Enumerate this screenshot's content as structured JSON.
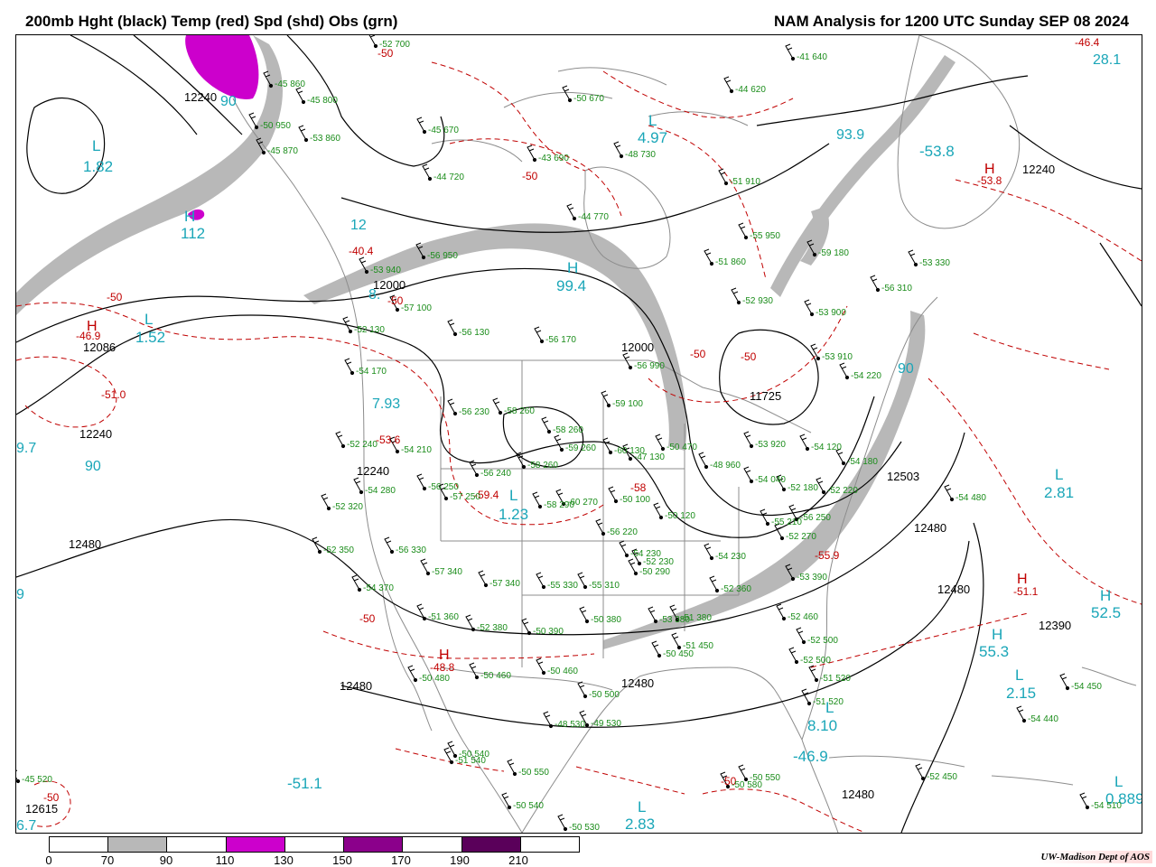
{
  "header": {
    "left_title": "200mb Hght (black) Temp (red) Spd (shd) Obs (grn)",
    "right_title": "NAM Analysis for 1200 UTC Sunday  SEP 08 2024"
  },
  "height_labels": [
    "12240",
    "12000",
    "12086",
    "12240",
    "12240",
    "12480",
    "12480",
    "12000",
    "11725",
    "12503",
    "12480",
    "12480",
    "12390",
    "12480",
    "12480",
    "12615",
    "12240"
  ],
  "temp_labels": [
    "-40.4",
    "-50",
    "-46.9",
    "-51.0",
    "-50",
    "-53.6",
    "-50",
    "-50",
    "-50",
    "-53.8",
    "-46.4",
    "-50",
    "-51.1",
    "-48.8",
    "-55.9",
    "-50",
    "-50",
    "-59.4",
    "-58",
    "-50"
  ],
  "pressure_centers": [
    {
      "symbol": "H",
      "value": "-46.9"
    },
    {
      "symbol": "L",
      "value": "1.82"
    },
    {
      "symbol": "H",
      "value": "112"
    },
    {
      "symbol": "L",
      "value": "1.52"
    },
    {
      "symbol": "H",
      "value": "99.4"
    },
    {
      "symbol": "L",
      "value": "4.97"
    },
    {
      "symbol": "L",
      "value": "1.23"
    },
    {
      "symbol": "L",
      "value": "2.81"
    },
    {
      "symbol": "H",
      "value": "55.3"
    },
    {
      "symbol": "L",
      "value": "2.15"
    },
    {
      "symbol": "H",
      "value": "52.5"
    },
    {
      "symbol": "L",
      "value": "2.83"
    },
    {
      "symbol": "L",
      "value": "8.10"
    },
    {
      "symbol": "H",
      "value": "-53.8"
    },
    {
      "symbol": "L",
      "value": "0.889"
    },
    {
      "symbol": "H",
      "value": "-51.1"
    }
  ],
  "speed_labels": [
    "7.93",
    "90",
    "93.9",
    "28.1",
    "90",
    "9.7",
    "9",
    "6.7",
    "8.",
    "90",
    "12"
  ],
  "observations": [
    "-45 860",
    "-45 800",
    "-50 950",
    "-53 860",
    "-52 700",
    "-53 940",
    "-45 870",
    "-45 670",
    "-44 720",
    "-43 690",
    "-50 670",
    "-48 730",
    "-41 640",
    "-44 620",
    "-51 910",
    "-55 950",
    "-44 770",
    "-59 180",
    "-51 860",
    "-53 330",
    "-52 930",
    "-53 900",
    "-53 910",
    "-56 950",
    "-56 310",
    "-57 100",
    "-56 130",
    "-56 170",
    "-52 130",
    "-54 170",
    "-52 240",
    "-54 210",
    "-56 230",
    "-58 260",
    "-58 260",
    "-59 260",
    "-60 130",
    "-59 100",
    "-56 990",
    "-54 220",
    "-54 180",
    "-54 120",
    "-54 280",
    "-56 250",
    "-57 250",
    "-56 240",
    "-58 260",
    "-58 290",
    "-60 270",
    "-56 220",
    "-48 960",
    "-53 920",
    "-54 040",
    "-52 180",
    "-52 220",
    "-52 320",
    "-52 350",
    "-56 330",
    "-57 340",
    "-57 340",
    "-55 330",
    "-55 310",
    "-54 230",
    "-54 230",
    "-55 210",
    "-52 270",
    "-56 250",
    "-53 390",
    "-54 370",
    "-51 360",
    "-52 380",
    "-50 390",
    "-50 380",
    "-53 380",
    "-51 380",
    "-52 360",
    "-52 460",
    "-52 500",
    "-52 500",
    "-51 520",
    "-51 520",
    "-54 480",
    "-54 450",
    "-54 440",
    "-51 450",
    "-50 450",
    "-50 460",
    "-50 480",
    "-50 460",
    "-50 500",
    "-48 530",
    "-49 530",
    "-51 540",
    "-50 540",
    "-50 550",
    "-50 540",
    "-50 530",
    "-50 550",
    "-50 580",
    "-52 450",
    "-54 510",
    "-45 520",
    "-50 290",
    "-50 100",
    "-50 120",
    "-52 230",
    "-47 130",
    "-50 470"
  ],
  "legend": {
    "colors": [
      "#ffffff",
      "#b8b8b8",
      "#ffffff",
      "#cc00cc",
      "#ffffff",
      "#8b008b",
      "#ffffff",
      "#5a005a",
      "#ffffff"
    ],
    "ticks": [
      "0",
      "70",
      "90",
      "110",
      "130",
      "150",
      "170",
      "190",
      "210"
    ]
  },
  "credit": "UW-Madison   Dept of AOS"
}
